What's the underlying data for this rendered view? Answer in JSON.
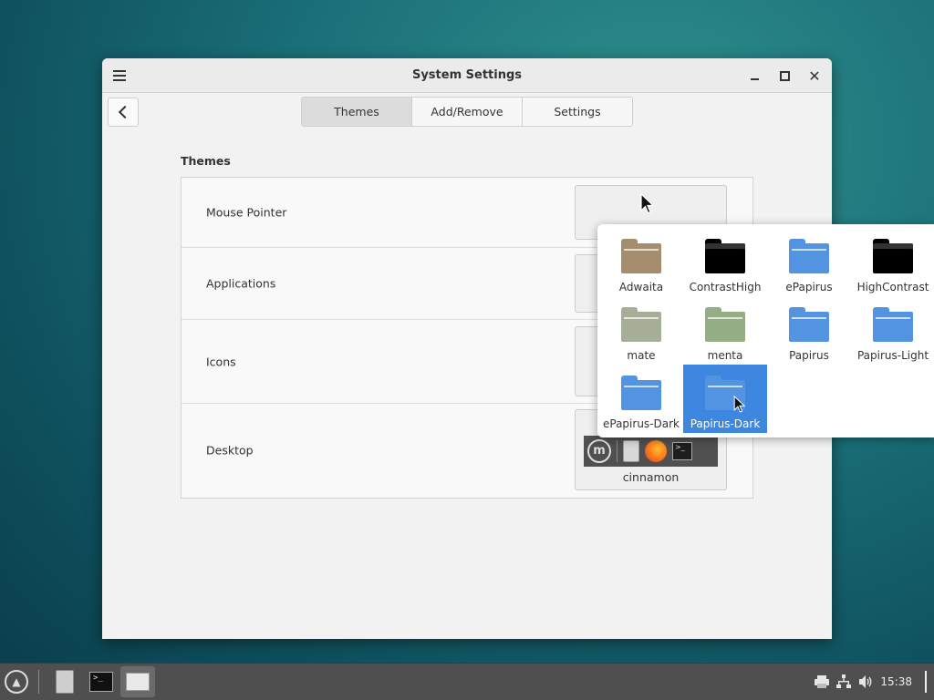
{
  "window": {
    "title": "System Settings"
  },
  "tabs": [
    {
      "label": "Themes",
      "active": true
    },
    {
      "label": "Add/Remove",
      "active": false
    },
    {
      "label": "Settings",
      "active": false
    }
  ],
  "section_title": "Themes",
  "rows": [
    {
      "label": "Mouse Pointer",
      "value": ""
    },
    {
      "label": "Applications",
      "value": ""
    },
    {
      "label": "Icons",
      "value": ""
    },
    {
      "label": "Desktop",
      "value": "cinnamon"
    }
  ],
  "icon_themes": [
    {
      "name": "Adwaita",
      "color": "#a58e6e",
      "selected": false
    },
    {
      "name": "ContrastHigh",
      "color": "#000000",
      "selected": false
    },
    {
      "name": "ePapirus",
      "color": "#5294e2",
      "selected": false
    },
    {
      "name": "HighContrast",
      "color": "#000000",
      "selected": false
    },
    {
      "name": "mate",
      "color": "#a7ae98",
      "selected": false
    },
    {
      "name": "menta",
      "color": "#95ad84",
      "selected": false
    },
    {
      "name": "Papirus",
      "color": "#5294e2",
      "selected": false
    },
    {
      "name": "Papirus-Light",
      "color": "#5294e2",
      "selected": false
    },
    {
      "name": "ePapirus-Dark",
      "color": "#5294e2",
      "selected": false
    },
    {
      "name": "Papirus-Dark",
      "color": "#5294e2",
      "selected": true
    }
  ],
  "taskbar": {
    "clock": "15:38",
    "launchers": [
      "menu-icon",
      "file-manager-icon",
      "terminal-icon",
      "system-settings-icon"
    ],
    "tray": [
      "printer-icon",
      "network-icon",
      "volume-icon"
    ]
  },
  "colors": {
    "accent": "#3d87e0",
    "window_bg": "#f2f2f2",
    "taskbar_bg": "#4f4f4f"
  }
}
